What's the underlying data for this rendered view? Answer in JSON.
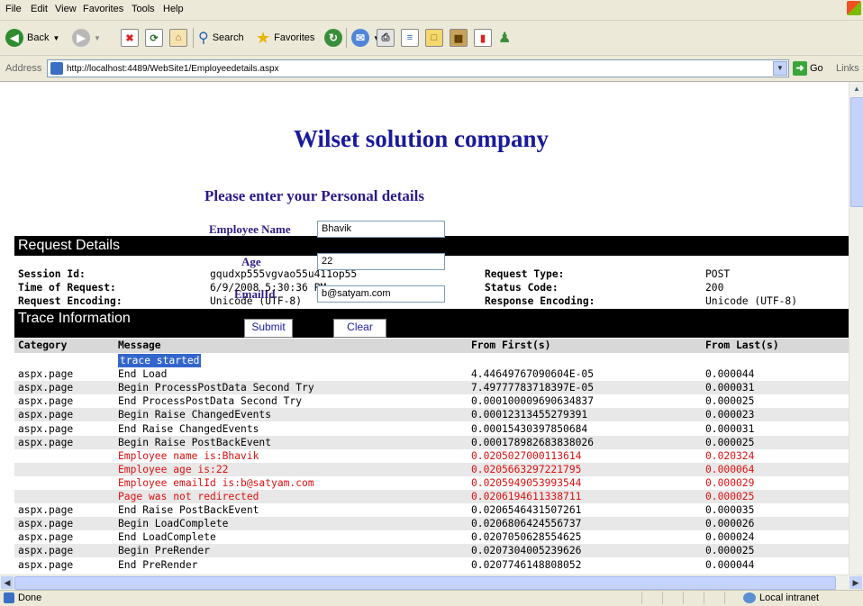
{
  "menu": [
    "File",
    "Edit",
    "View",
    "Favorites",
    "Tools",
    "Help"
  ],
  "toolbar": {
    "back": "Back",
    "search": "Search",
    "favorites": "Favorites"
  },
  "address": {
    "label": "Address",
    "url": "http://localhost:4489/WebSite1/Employeedetails.aspx",
    "go": "Go",
    "links": "Links"
  },
  "page": {
    "title": "Wilset solution company",
    "subtitle": "Please enter your Personal details",
    "fields": {
      "name_label": "Employee Name",
      "name_value": "Bhavik",
      "age_label": "Age",
      "age_value": "22",
      "email_label": "EmailId",
      "email_value": "b@satyam.com"
    },
    "buttons": {
      "submit": "Submit",
      "clear": "Clear"
    }
  },
  "request_details": {
    "header": "Request Details",
    "session_label": "Session Id:",
    "session_value": "gqudxp555vgvao55u411op55",
    "time_label": "Time of Request:",
    "time_value": "6/9/2008 5:30:36 PM",
    "req_enc_label": "Request Encoding:",
    "req_enc_value": "Unicode (UTF-8)",
    "type_label": "Request Type:",
    "type_value": "POST",
    "status_label": "Status Code:",
    "status_value": "200",
    "resp_enc_label": "Response Encoding:",
    "resp_enc_value": "Unicode (UTF-8)"
  },
  "trace": {
    "header": "Trace Information",
    "columns": [
      "Category",
      "Message",
      "From First(s)",
      "From Last(s)"
    ],
    "rows": [
      {
        "cat": "",
        "msg": "trace started",
        "first": "",
        "last": ""
      },
      {
        "cat": "aspx.page",
        "msg": "End Load",
        "first": "4.44649767090604E-05",
        "last": "0.000044"
      },
      {
        "cat": "aspx.page",
        "msg": "Begin ProcessPostData Second Try",
        "first": "7.49777783718397E-05",
        "last": "0.000031"
      },
      {
        "cat": "aspx.page",
        "msg": "End ProcessPostData Second Try",
        "first": "0.000100009690634837",
        "last": "0.000025"
      },
      {
        "cat": "aspx.page",
        "msg": "Begin Raise ChangedEvents",
        "first": "0.00012313455279391",
        "last": "0.000023"
      },
      {
        "cat": "aspx.page",
        "msg": "End Raise ChangedEvents",
        "first": "0.00015430397850684",
        "last": "0.000031"
      },
      {
        "cat": "aspx.page",
        "msg": "Begin Raise PostBackEvent",
        "first": "0.000178982683838026",
        "last": "0.000025"
      },
      {
        "cat": "",
        "msg": "Employee name is:Bhavik",
        "first": "0.0205027000113614",
        "last": "0.020324"
      },
      {
        "cat": "",
        "msg": "Employee age is:22",
        "first": "0.0205663297221795",
        "last": "0.000064"
      },
      {
        "cat": "",
        "msg": "Employee emailId is:b@satyam.com",
        "first": "0.0205949053993544",
        "last": "0.000029"
      },
      {
        "cat": "",
        "msg": "Page was not redirected",
        "first": "0.0206194611338711",
        "last": "0.000025"
      },
      {
        "cat": "aspx.page",
        "msg": "End Raise PostBackEvent",
        "first": "0.0206546431507261",
        "last": "0.000035"
      },
      {
        "cat": "aspx.page",
        "msg": "Begin LoadComplete",
        "first": "0.0206806424556737",
        "last": "0.000026"
      },
      {
        "cat": "aspx.page",
        "msg": "End LoadComplete",
        "first": "0.0207050628554625",
        "last": "0.000024"
      },
      {
        "cat": "aspx.page",
        "msg": "Begin PreRender",
        "first": "0.0207304005239626",
        "last": "0.000025"
      },
      {
        "cat": "aspx.page",
        "msg": "End PreRender",
        "first": "0.0207746148808052",
        "last": "0.000044"
      }
    ]
  },
  "status": {
    "text": "Done",
    "zone": "Local intranet"
  }
}
